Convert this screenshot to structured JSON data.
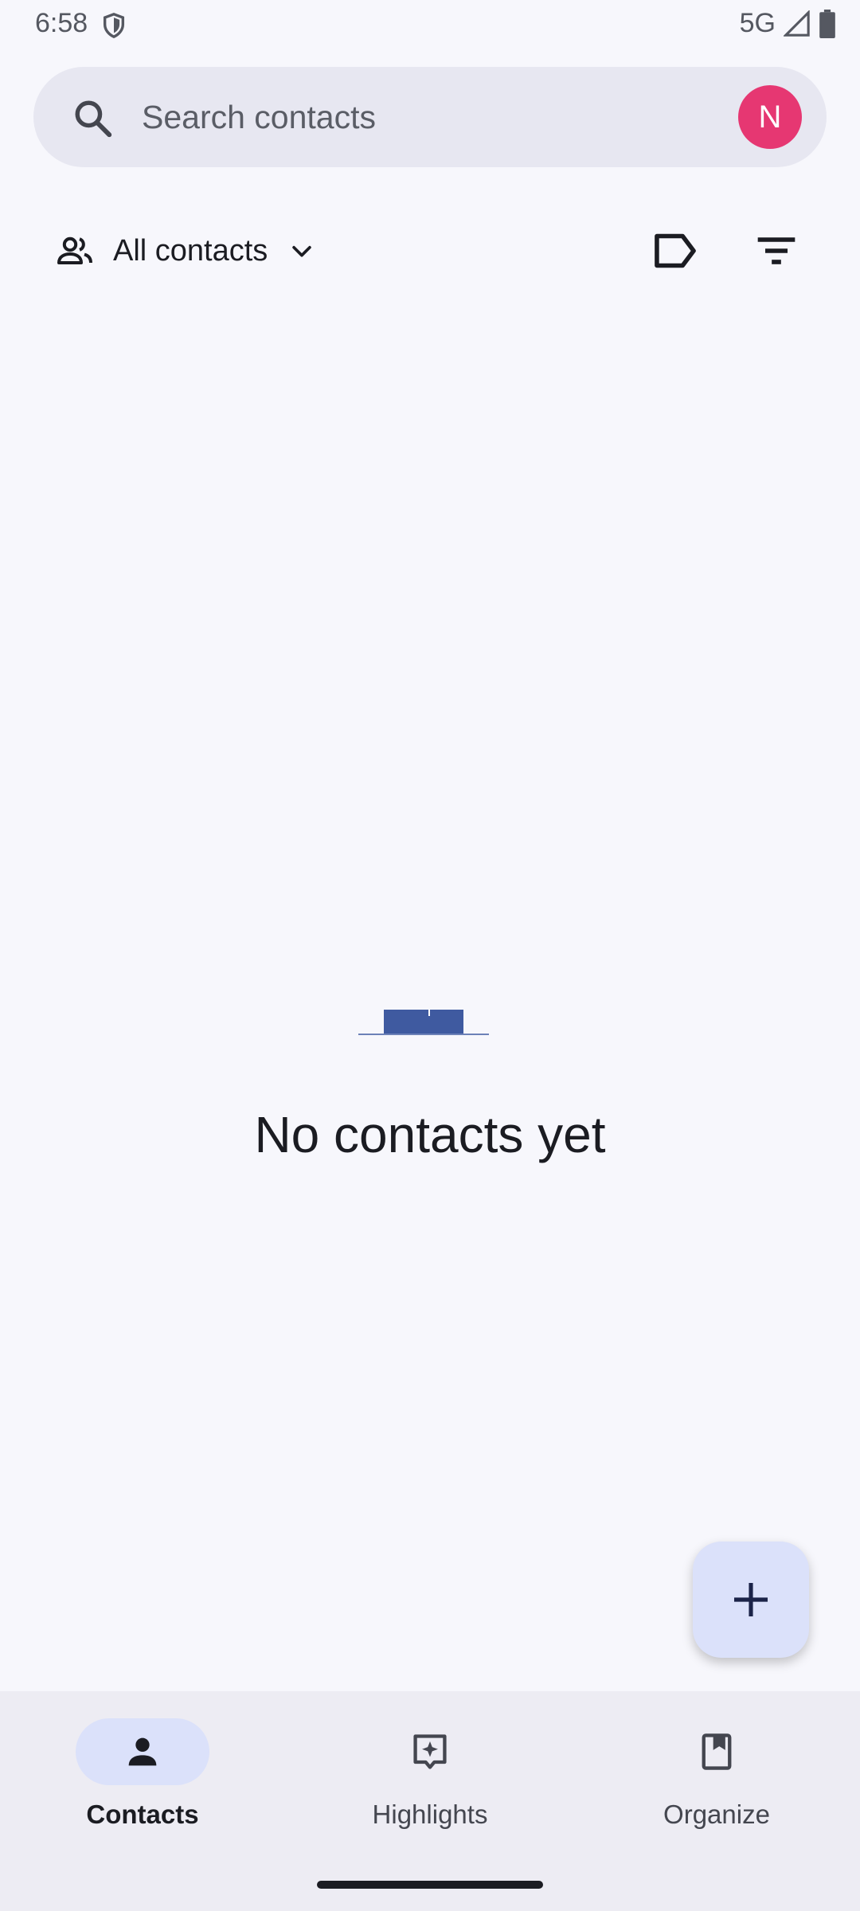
{
  "status_bar": {
    "time": "6:58",
    "network": "5G",
    "icons": [
      "shield-icon",
      "signal-icon",
      "battery-icon"
    ]
  },
  "search": {
    "placeholder": "Search contacts",
    "avatar_initial": "N",
    "avatar_color": "#e63772"
  },
  "filter_bar": {
    "dropdown_label": "All contacts",
    "icons": [
      "people-icon",
      "chevron-down-icon",
      "label-icon",
      "filter-icon"
    ]
  },
  "empty_state": {
    "title": "No contacts yet"
  },
  "fab": {
    "icon": "plus-icon"
  },
  "bottom_nav": {
    "items": [
      {
        "label": "Contacts",
        "icon": "person-icon",
        "active": true
      },
      {
        "label": "Highlights",
        "icon": "highlights-icon",
        "active": false
      },
      {
        "label": "Organize",
        "icon": "bookmark-icon",
        "active": false
      }
    ]
  },
  "colors": {
    "background": "#f7f7fc",
    "search_bar": "#e7e7f1",
    "accent_container": "#dbe1fa",
    "nav_background": "#edecf3",
    "illustration": "#3f5aa0"
  }
}
